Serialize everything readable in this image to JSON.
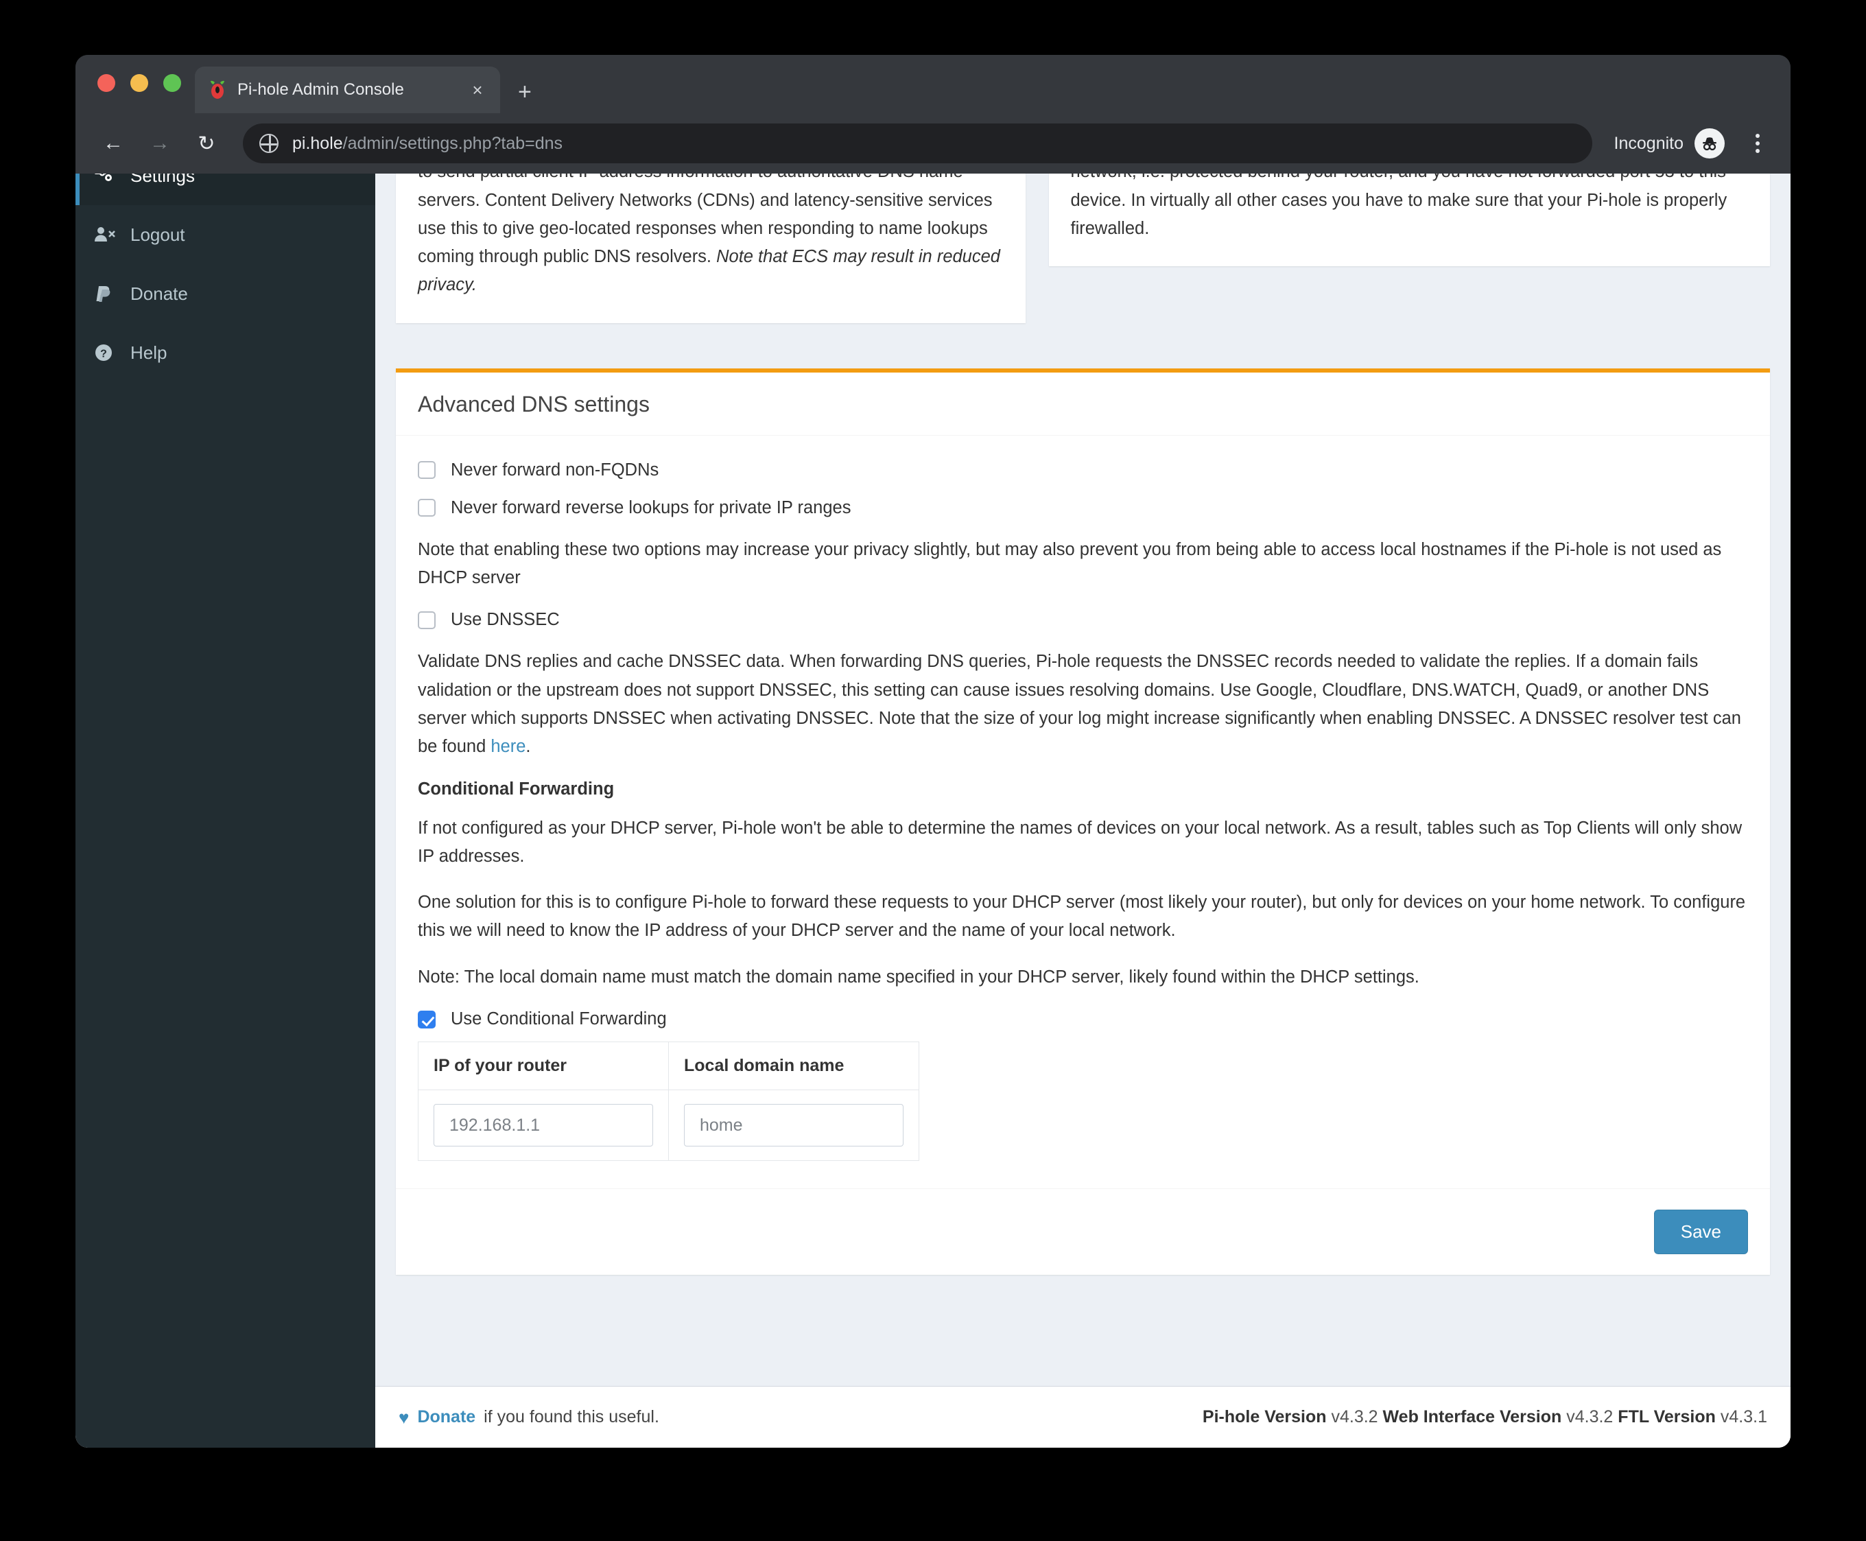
{
  "browser": {
    "tab_title": "Pi-hole Admin Console",
    "tab_close": "×",
    "new_tab": "+",
    "back_icon": "←",
    "forward_icon": "→",
    "reload_icon": "↻",
    "url_bold": "pi.hole",
    "url_rest": "/admin/settings.php?tab=dns",
    "incognito_label": "Incognito"
  },
  "sidebar": {
    "items": [
      {
        "label": "Settings",
        "icon": "sliders-gear-icon",
        "active": true
      },
      {
        "label": "Logout",
        "icon": "user-times-icon",
        "active": false
      },
      {
        "label": "Donate",
        "icon": "paypal-icon",
        "active": false
      },
      {
        "label": "Help",
        "icon": "question-circle-icon",
        "active": false
      }
    ]
  },
  "panels": {
    "ecs_text_plain": "ECS (Extended Client Subnet) defines a mechanism for recursive resolvers to send partial client IP address information to authoritative DNS name servers. Content Delivery Networks (CDNs) and latency-sensitive services use this to give geo-located responses when responding to name lookups coming through public DNS resolvers. ",
    "ecs_text_italic": "Note that ECS may result in reduced privacy.",
    "interface_text": "connected to the Internet. This option is safe if your Pi-hole is located within your local network, i.e. protected behind your router, and you have not forwarded port 53 to this device. In virtually all other cases you have to make sure that your Pi-hole is properly firewalled."
  },
  "advanced": {
    "title": "Advanced DNS settings",
    "checkbox_fqdn": {
      "label": "Never forward non-FQDNs",
      "checked": false
    },
    "checkbox_reverse": {
      "label": "Never forward reverse lookups for private IP ranges",
      "checked": false
    },
    "note_options": "Note that enabling these two options may increase your privacy slightly, but may also prevent you from being able to access local hostnames if the Pi-hole is not used as DHCP server",
    "checkbox_dnssec": {
      "label": "Use DNSSEC",
      "checked": false
    },
    "dnssec_text_before_link": "Validate DNS replies and cache DNSSEC data. When forwarding DNS queries, Pi-hole requests the DNSSEC records needed to validate the replies. If a domain fails validation or the upstream does not support DNSSEC, this setting can cause issues resolving domains. Use Google, Cloudflare, DNS.WATCH, Quad9, or another DNS server which supports DNSSEC when activating DNSSEC. Note that the size of your log might increase significantly when enabling DNSSEC. A DNSSEC resolver test can be found ",
    "dnssec_link_text": "here",
    "dnssec_text_after_link": ".",
    "conditional_heading": "Conditional Forwarding",
    "conditional_p1": "If not configured as your DHCP server, Pi-hole won't be able to determine the names of devices on your local network. As a result, tables such as Top Clients will only show IP addresses.",
    "conditional_p2": "One solution for this is to configure Pi-hole to forward these requests to your DHCP server (most likely your router), but only for devices on your home network. To configure this we will need to know the IP address of your DHCP server and the name of your local network.",
    "conditional_p3": "Note: The local domain name must match the domain name specified in your DHCP server, likely found within the DHCP settings.",
    "checkbox_conditional": {
      "label": "Use Conditional Forwarding",
      "checked": true
    },
    "table": {
      "headers": [
        "IP of your router",
        "Local domain name"
      ],
      "router_ip_value": "192.168.1.1",
      "local_domain_value": "home"
    },
    "save_label": "Save"
  },
  "footer": {
    "donate_link": "Donate",
    "donate_rest": "if you found this useful.",
    "pihole_version_label": "Pi-hole Version",
    "pihole_version_value": "v4.3.2",
    "web_version_label": "Web Interface Version",
    "web_version_value": "v4.3.2",
    "ftl_version_label": "FTL Version",
    "ftl_version_value": "v4.3.1"
  },
  "colors": {
    "accent_orange": "#f39c12",
    "primary_blue": "#3c8dbc",
    "checkbox_blue": "#2f7fef",
    "sidebar_bg": "#222d32",
    "content_bg": "#ecf0f5"
  }
}
